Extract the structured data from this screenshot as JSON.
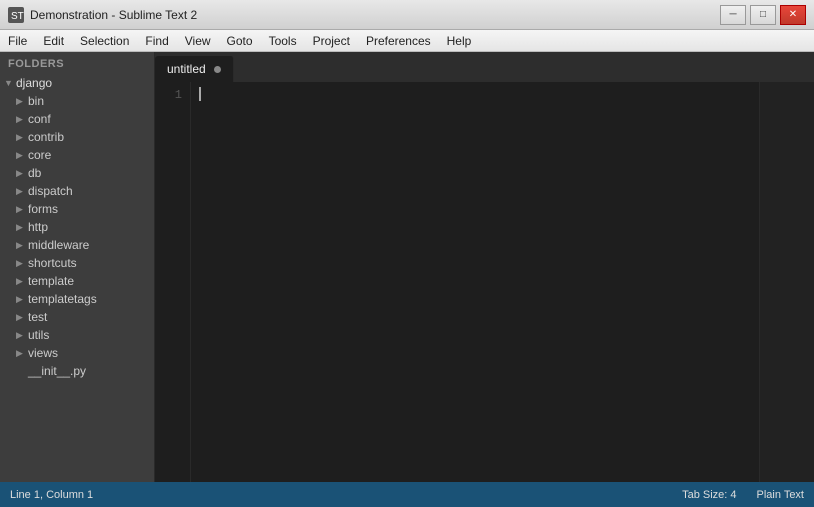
{
  "titleBar": {
    "title": "Demonstration - Sublime Text 2",
    "iconSymbol": "◆",
    "minimizeLabel": "─",
    "maximizeLabel": "□",
    "closeLabel": "✕"
  },
  "menuBar": {
    "items": [
      {
        "label": "File",
        "id": "file"
      },
      {
        "label": "Edit",
        "id": "edit"
      },
      {
        "label": "Selection",
        "id": "selection"
      },
      {
        "label": "Find",
        "id": "find"
      },
      {
        "label": "View",
        "id": "view"
      },
      {
        "label": "Goto",
        "id": "goto"
      },
      {
        "label": "Tools",
        "id": "tools"
      },
      {
        "label": "Project",
        "id": "project"
      },
      {
        "label": "Preferences",
        "id": "preferences"
      },
      {
        "label": "Help",
        "id": "help"
      }
    ]
  },
  "sidebar": {
    "foldersLabel": "FOLDERS",
    "rootItem": "django",
    "children": [
      {
        "label": "bin",
        "hasChildren": true
      },
      {
        "label": "conf",
        "hasChildren": true
      },
      {
        "label": "contrib",
        "hasChildren": true
      },
      {
        "label": "core",
        "hasChildren": true
      },
      {
        "label": "db",
        "hasChildren": true
      },
      {
        "label": "dispatch",
        "hasChildren": true
      },
      {
        "label": "forms",
        "hasChildren": true
      },
      {
        "label": "http",
        "hasChildren": true
      },
      {
        "label": "middleware",
        "hasChildren": true
      },
      {
        "label": "shortcuts",
        "hasChildren": true
      },
      {
        "label": "template",
        "hasChildren": true
      },
      {
        "label": "templatetags",
        "hasChildren": true
      },
      {
        "label": "test",
        "hasChildren": true
      },
      {
        "label": "utils",
        "hasChildren": true
      },
      {
        "label": "views",
        "hasChildren": true
      },
      {
        "label": "__init__.py",
        "hasChildren": false
      }
    ]
  },
  "editor": {
    "tabName": "untitled",
    "lineNumbers": [
      "1"
    ],
    "content": ""
  },
  "statusBar": {
    "position": "Line 1, Column 1",
    "tabSize": "Tab Size: 4",
    "syntax": "Plain Text"
  }
}
